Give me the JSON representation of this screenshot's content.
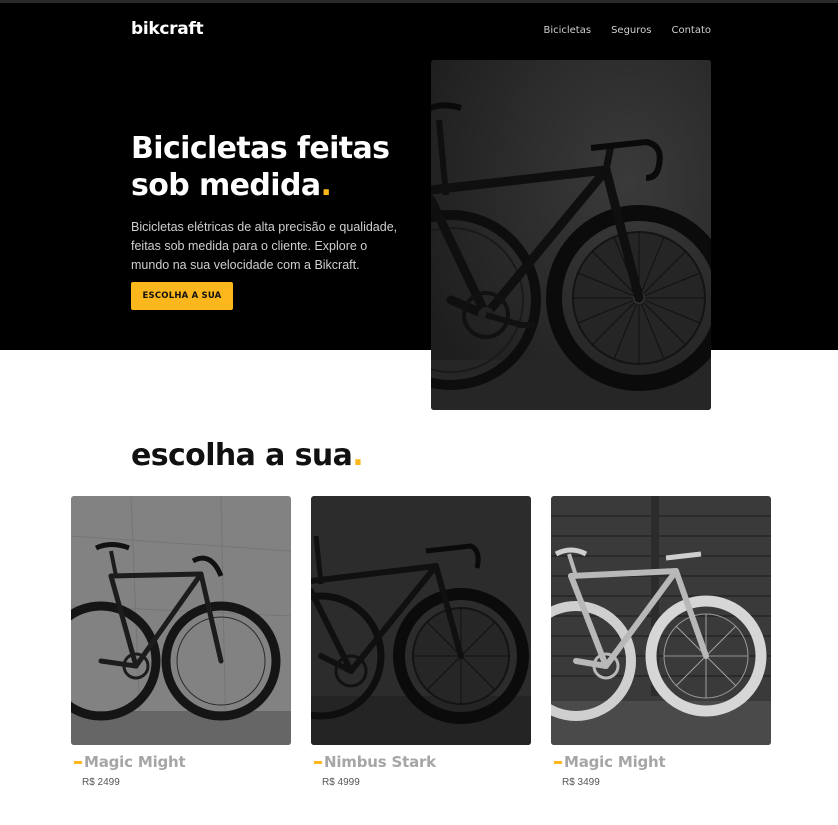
{
  "header": {
    "logo": "bikcraft",
    "nav": [
      "Bicicletas",
      "Seguros",
      "Contato"
    ]
  },
  "hero": {
    "title_line1": "Bicicletas feitas",
    "title_line2": "sob medida",
    "title_dot": ".",
    "description": "Bicicletas elétricas de alta precisão e qualidade, feitas sob medida para o cliente. Explore o mundo na sua velocidade com a Bikcraft.",
    "button": "ESCOLHA A SUA"
  },
  "products_section": {
    "title": "escolha a sua",
    "title_dot": "."
  },
  "products": [
    {
      "name": "Magic Might",
      "price": "R$ 2499"
    },
    {
      "name": "Nimbus Stark",
      "price": "R$ 4999"
    },
    {
      "name": "Magic Might",
      "price": "R$ 3499"
    }
  ],
  "colors": {
    "accent": "#fbb71b",
    "hero_bg": "#000000",
    "text_dark": "#111111",
    "product_name": "#a6a6a6"
  },
  "icons": [
    "bicycle-photo"
  ]
}
